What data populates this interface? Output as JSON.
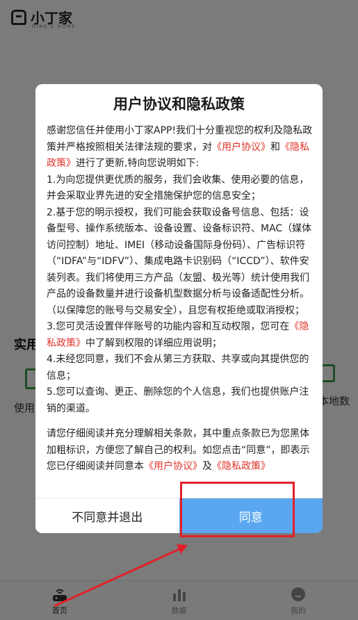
{
  "app": {
    "logo_text": "小丁家",
    "logo_sub": "DING'S HOME",
    "section_title": "实用",
    "left_item_text": "使用",
    "right_item_text": "本地数"
  },
  "bottom_nav": [
    {
      "label": "首页",
      "icon": "router-icon",
      "active": true
    },
    {
      "label": "数据",
      "icon": "bar-chart-icon",
      "active": false
    },
    {
      "label": "我的",
      "icon": "profile-icon",
      "active": false
    }
  ],
  "dialog": {
    "title": "用户协议和隐私政策",
    "intro_a": "感谢您信任并使用小丁家APP!我们十分重视您的权利及隐私政策并严格按照相关法律法规的要求，对",
    "link_user_agreement": "《用户协议》",
    "intro_and": "和",
    "link_privacy_policy": "《隐私政策》",
    "intro_b": "进行了更新,特向您说明如下:",
    "item1": "1.为向您提供更优质的服务，我们会收集、使用必要的信息，并会采取业界先进的安全措施保护您的信息安全；",
    "item2": "2.基于您的明示授权，我们可能会获取设备号信息、包括：设备型号、操作系统版本、设备设置、设备标识符、MAC（媒体访问控制）地址、IMEI（移动设备国际身份码）、广告标识符（“IDFA”与“IDFV”）、集成电路卡识别码（“ICCD”）、软件安装列表。我们将使用三方产品（友盟、极光等）统计使用我们产品的设备数量并进行设备机型数据分析与设备适配性分析。（以保障您的账号与交易安全），且您有权拒绝或取消授权；",
    "item3_a": "3.您可灵活设置伴伴账号的功能内容和互动权限，您可在",
    "item3_b": "中了解到权限的详细应用说明；",
    "item4": "4.未经您同意，我们不会从第三方获取、共享或向其提供您的信息；",
    "item5": "5.您可以查询、更正、删除您的个人信息，我们也提供账户注销的渠道。",
    "outro_a": "请您仔细阅读并充分理解相关条款，其中重点条款已为您黑体加粗标识，方便您了解自己的权利。如您点击“同意”，即表示您已仔细阅读并同意本",
    "outro_and": "及",
    "decline_label": "不同意并退出",
    "agree_label": "同意"
  },
  "colors": {
    "link": "#e0332b",
    "agree_button": "#5aa7f0",
    "annotation": "#e3202a"
  }
}
